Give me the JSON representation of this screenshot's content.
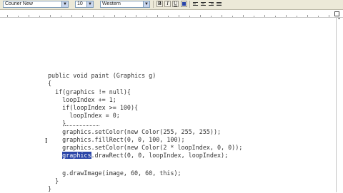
{
  "toolbar": {
    "font_name": "Courier New",
    "font_size": "10",
    "script": "Western",
    "bold_label": "B",
    "italic_label": "I",
    "underline_label": "U"
  },
  "editor": {
    "code_lines": [
      "public void paint (Graphics g)",
      "{",
      "  if(graphics != null){",
      "    loopIndex += 1;",
      "    if(loopIndex >= 100){",
      "      loopIndex = 0;",
      "    }",
      "    graphics.setColor(new Color(255, 255, 255));",
      "    graphics.fillRect(0, 0, 100, 100);",
      "    graphics.setColor(new Color(2 * loopIndex, 0, 0));",
      "    ",
      "",
      "    g.drawImage(image, 60, 60, this);",
      "  }",
      "}"
    ],
    "highlight_prefix": "    ",
    "highlight_text": "graphics",
    "highlight_rest": ".drawRect(0, 0, loopIndex, loopIndex);"
  }
}
